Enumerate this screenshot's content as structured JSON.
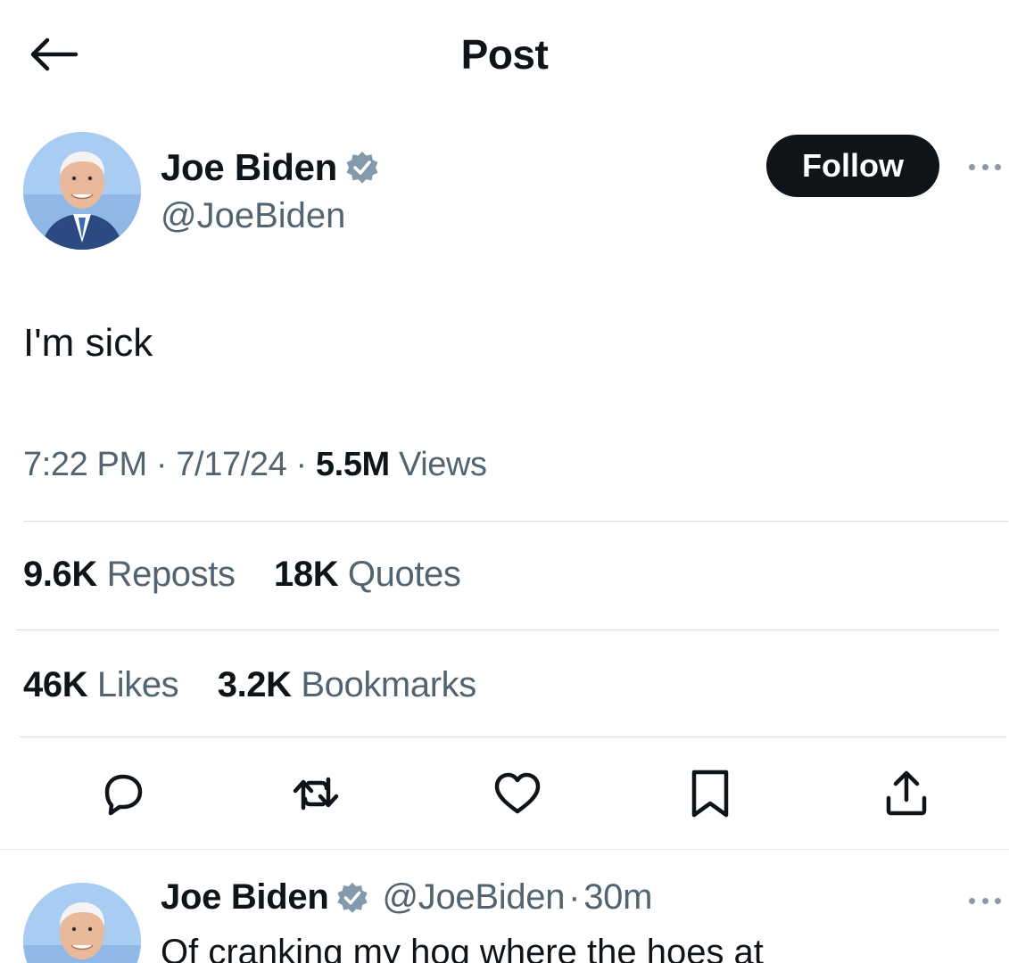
{
  "header": {
    "title": "Post",
    "back_icon": "arrow-left-icon"
  },
  "post": {
    "author": {
      "name": "Joe Biden",
      "handle": "@JoeBiden",
      "verified": true,
      "badge_color": "#829aab"
    },
    "follow_label": "Follow",
    "more_icon": "ellipsis-icon",
    "text": "I'm sick",
    "meta": {
      "time": "7:22 PM",
      "separator": "·",
      "date": "7/17/24",
      "views_count": "5.5M",
      "views_label": "Views"
    },
    "stats_row1": {
      "reposts_count": "9.6K",
      "reposts_label": "Reposts",
      "quotes_count": "18K",
      "quotes_label": "Quotes"
    },
    "stats_row2": {
      "likes_count": "46K",
      "likes_label": "Likes",
      "bookmarks_count": "3.2K",
      "bookmarks_label": "Bookmarks"
    },
    "actions": [
      "reply-icon",
      "repost-icon",
      "like-icon",
      "bookmark-icon",
      "share-icon"
    ]
  },
  "reply": {
    "author_name": "Joe Biden",
    "handle": "@JoeBiden",
    "separator": "·",
    "time": "30m",
    "text": "Of cranking my hog where the hoes at"
  },
  "colors": {
    "primary_text": "#0f1419",
    "secondary_text": "#536471",
    "divider": "#d7dde2",
    "follow_bg": "#0f1419",
    "avatar_bg": "#9cc4ee"
  }
}
